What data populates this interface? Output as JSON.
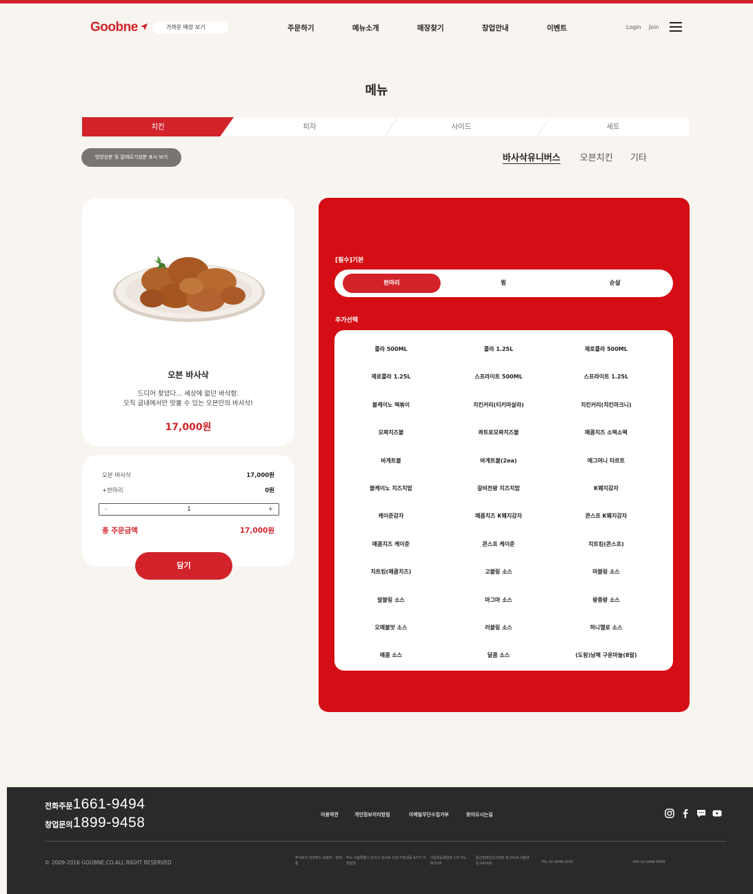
{
  "header": {
    "logo": "Goobne",
    "store_finder": "가까운 매장 보기",
    "nav": [
      "주문하기",
      "메뉴소개",
      "매장찾기",
      "창업안내",
      "이벤트"
    ],
    "login": "Login",
    "join": "Join"
  },
  "page_title": "메뉴",
  "category_tabs": [
    "치킨",
    "피자",
    "사이드",
    "세트"
  ],
  "nutrition_button": "영양성분 및 알레르기성분 표시 보기",
  "sub_tabs": [
    "바사삭유니버스",
    "오븐치킨",
    "기타"
  ],
  "product": {
    "name": "오븐 바사삭",
    "description_line1": "드디어 찾았다... 세상에 없던 바삭함.",
    "description_line2": "오직 굽네에서만 맛볼 수 있는 오븐만의 바사삭!",
    "price": "17,000원"
  },
  "summary": {
    "item_label": "오븐 바사삭",
    "item_price": "17,000원",
    "option_label": "+한마리",
    "option_price": "0원",
    "qty_minus": "-",
    "qty": "1",
    "qty_plus": "+",
    "total_label": "총 주문금액",
    "total_price": "17,000원",
    "add_button": "담기"
  },
  "options": {
    "required_label": "[필수]기본",
    "sizes": [
      "한마리",
      "윙",
      "순살"
    ],
    "extra_label": "추가선택",
    "extras": [
      "콜라 500ML",
      "콜라 1.25L",
      "제로콜라 500ML",
      "제로콜라 1.25L",
      "스프라이트 500ML",
      "스프라이트 1.25L",
      "볼케이노 떡볶이",
      "치킨커리(티키마살라)",
      "치킨커리(치킨마크니)",
      "모짜치즈볼",
      "콰트로모짜치즈볼",
      "매콤치즈 소떡소떡",
      "바게트볼",
      "바게트볼(2ea)",
      "에그머니 타르트",
      "볼케이노 치즈치밥",
      "갈비천왕 치즈치밥",
      "K웨지감자",
      "케이준감자",
      "매콤치즈 K웨지감자",
      "콘스프 K웨지감자",
      "매콤치즈 케이준",
      "콘스프 케이준",
      "치트킹(콘스프)",
      "치트킹(매콤치즈)",
      "고블링 소스",
      "마블링 소스",
      "알블링 소스",
      "마그마 소스",
      "왕중왕 소스",
      "오메불맛 소스",
      "러블링 소스",
      "허니멜로 소스",
      "매콤 소스",
      "달콤 소스",
      "(도핑)남해 구운마늘(8알)"
    ]
  },
  "footer": {
    "phone_order_label": "전화주문",
    "phone_order": "1661-9494",
    "franchise_label": "창업문의",
    "franchise_phone": "1899-9458",
    "links": [
      "이용약관",
      "개인정보처리방침",
      "이메일무단수집거부",
      "찾아오시는길"
    ],
    "copyright": "© 2009-2016 GOOBNE.CO.ALL RIGHT RESERVED",
    "corp_info": [
      "주식회사 지엔푸드 대표자 : 정태용",
      "주소 서울특별시 강서구 강서로 318 지엔성동 6가기 지엔빌딩",
      "사업자등록번호 137-81-80324",
      "통신판매업신고번호 제 2014-서울양천-0426호",
      "TEL 02-2648-2005",
      "FAX 02-2648-9458"
    ]
  }
}
